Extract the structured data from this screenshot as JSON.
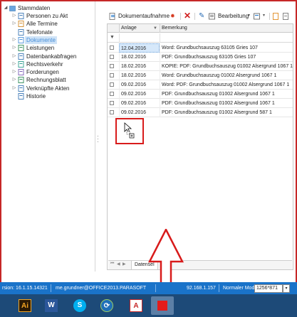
{
  "tree": {
    "root": "Stammdaten",
    "items": [
      {
        "label": "Personen zu Akt",
        "expandable": true,
        "icon": "people-icon"
      },
      {
        "label": "Alle Termine",
        "expandable": true,
        "icon": "calendar-icon"
      },
      {
        "label": "Telefonate",
        "expandable": false,
        "icon": "phone-icon"
      },
      {
        "label": "Dokumente",
        "expandable": true,
        "icon": "document-icon",
        "selected": true
      },
      {
        "label": "Leistungen",
        "expandable": true,
        "icon": "services-icon"
      },
      {
        "label": "Datenbankabfragen",
        "expandable": true,
        "icon": "database-icon"
      },
      {
        "label": "Rechtsverkehr",
        "expandable": true,
        "icon": "legal-icon"
      },
      {
        "label": "Forderungen",
        "expandable": true,
        "icon": "claims-icon"
      },
      {
        "label": "Rechnungsblatt",
        "expandable": true,
        "icon": "invoice-icon"
      },
      {
        "label": "Verknüpfte Akten",
        "expandable": true,
        "icon": "link-icon"
      },
      {
        "label": "Historie",
        "expandable": false,
        "icon": "history-icon"
      }
    ]
  },
  "toolbar": {
    "document_capture_label": "Dokumentaufnahme",
    "edit_label": "Bearbeitung"
  },
  "grid": {
    "columns": [
      "Anlage",
      "Bemerkung"
    ],
    "rows": [
      {
        "date": "12.04.2016",
        "desc": "Word: Grundbuchsauszug 63105 Gries 107",
        "selected": true
      },
      {
        "date": "18.02.2016",
        "desc": "PDF: Grundbuchsauszug 63105 Gries 107"
      },
      {
        "date": "18.02.2016",
        "desc": "KOPIE:  PDF: Grundbuchsauszug 01002 Alsergrund 1067 1"
      },
      {
        "date": "18.02.2016",
        "desc": "Word:   Grundbuchsauszug 01002 Alsergrund 1067 1"
      },
      {
        "date": "09.02.2016",
        "desc": "Word:  PDF: Grundbuchsauszug 01002 Alsergrund 1067 1"
      },
      {
        "date": "09.02.2016",
        "desc": " PDF: Grundbuchsauszug 01002 Alsergrund 1067 1"
      },
      {
        "date": "09.02.2016",
        "desc": "PDF: Grundbuchsauszug 01002 Alsergrund 1067 1"
      },
      {
        "date": "09.02.2016",
        "desc": "PDF: Grundbuchsauszug 01002 Alsergrund 587 1"
      }
    ],
    "bottom_tab": "Datensel"
  },
  "status": {
    "version": "rsion: 16.1.15.14321",
    "user": "me.grundner@OFFICE2013.PARASOFT",
    "ip": "92.168.1.157",
    "mode": "Normaler Modus",
    "resolution": "1256*871"
  },
  "taskbar": {
    "apps": [
      {
        "name": "illustrator",
        "glyph": "Ai"
      },
      {
        "name": "word",
        "glyph": "W"
      },
      {
        "name": "skype",
        "glyph": "S"
      },
      {
        "name": "update",
        "glyph": "⟳"
      },
      {
        "name": "pdf",
        "glyph": "A"
      },
      {
        "name": "active-app",
        "glyph": ""
      }
    ]
  },
  "colors": {
    "accent": "#1a73c9",
    "selection": "#cfe3f7",
    "highlight_red": "#d81b1b"
  }
}
